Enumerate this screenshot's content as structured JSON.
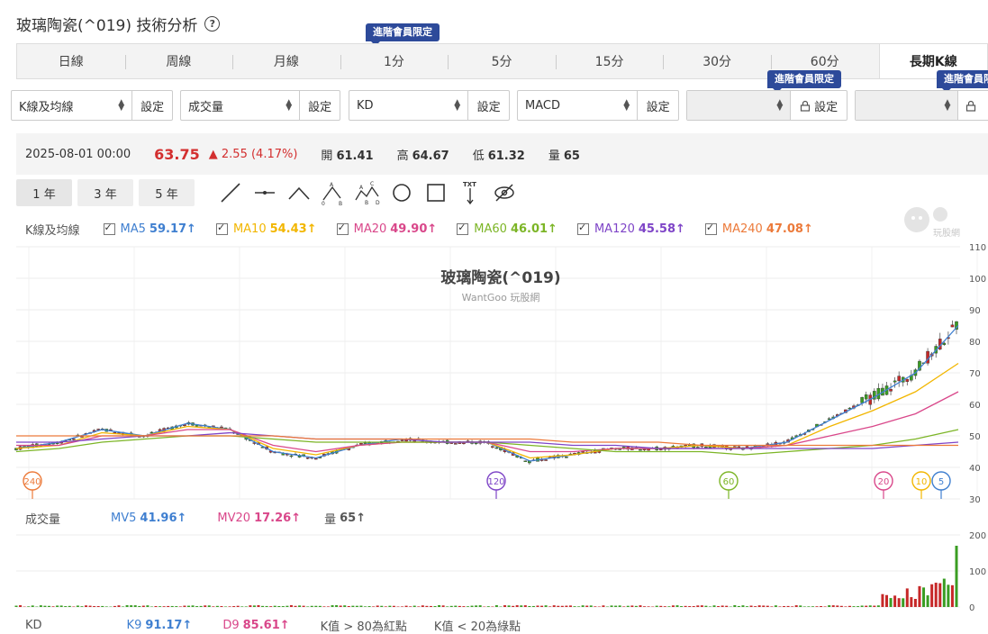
{
  "page": {
    "title": "玻璃陶瓷(^019) 技術分析",
    "help_icon": "help-icon"
  },
  "badges": {
    "minute": "進階會員限定",
    "settings": "進階會員限定",
    "settings2": "進階會員限定"
  },
  "tabs": [
    {
      "label": "日線"
    },
    {
      "label": "周線"
    },
    {
      "label": "月線"
    },
    {
      "label": "1分"
    },
    {
      "label": "5分"
    },
    {
      "label": "15分"
    },
    {
      "label": "30分"
    },
    {
      "label": "60分"
    },
    {
      "label": "長期K線",
      "active": true
    }
  ],
  "controls": {
    "sel1": "K線及均線",
    "sel2": "成交量",
    "sel3": "KD",
    "sel4": "MACD",
    "sel5": "",
    "sel6": "",
    "set_label": "設定"
  },
  "quote": {
    "date": "2025-08-01 00:00",
    "price": "63.75",
    "change": "▲ 2.55 (4.17%)",
    "open_label": "開",
    "open": "61.41",
    "high_label": "高",
    "high": "64.67",
    "low_label": "低",
    "low": "61.32",
    "vol_label": "量",
    "vol": "65"
  },
  "ranges": [
    "1 年",
    "3 年",
    "5 年"
  ],
  "ma": {
    "label": "K線及均線",
    "items": [
      {
        "name": "MA5",
        "value": "59.17↑",
        "color": "#3f7fd0"
      },
      {
        "name": "MA10",
        "value": "54.43↑",
        "color": "#f2b600"
      },
      {
        "name": "MA20",
        "value": "49.90↑",
        "color": "#d9478a"
      },
      {
        "name": "MA60",
        "value": "46.01↑",
        "color": "#7cb526"
      },
      {
        "name": "MA120",
        "value": "45.58↑",
        "color": "#7e44c7"
      },
      {
        "name": "MA240",
        "value": "47.08↑",
        "color": "#ec7a3a"
      }
    ]
  },
  "chart": {
    "title": "玻璃陶瓷(^019)",
    "subtitle": "WantGoo 玩股網",
    "logo_text": "玩股網",
    "y_ticks": [
      "110",
      "100",
      "90",
      "80",
      "70",
      "60",
      "50",
      "40",
      "30"
    ],
    "markers": [
      "240",
      "120",
      "60",
      "20",
      "10",
      "5"
    ]
  },
  "volume": {
    "label": "成交量",
    "mv5_name": "MV5",
    "mv5": "41.96↑",
    "mv20_name": "MV20",
    "mv20": "17.26↑",
    "q_name": "量",
    "q": "65↑",
    "y_ticks": [
      "200",
      "100",
      "0"
    ]
  },
  "kd": {
    "label": "KD",
    "k_name": "K9",
    "k": "91.17↑",
    "d_name": "D9",
    "d": "85.61↑",
    "note1": "K值 > 80為紅點",
    "note2": "K值 < 20為綠點"
  },
  "chart_data": {
    "type": "line",
    "title": "玻璃陶瓷(^019)",
    "ylim": [
      30,
      110
    ],
    "series": [
      {
        "name": "MA5",
        "values": [
          46,
          48,
          52,
          50,
          54,
          52,
          45,
          43,
          47,
          49,
          48,
          48,
          42,
          44,
          46,
          46,
          47,
          46,
          48,
          55,
          62,
          70,
          85
        ]
      },
      {
        "name": "MA10",
        "values": [
          46,
          47,
          51,
          50,
          53,
          52,
          46,
          44,
          47,
          48,
          48,
          48,
          43,
          44,
          46,
          46,
          47,
          46,
          47,
          53,
          58,
          64,
          73
        ]
      },
      {
        "name": "MA20",
        "values": [
          47,
          47,
          50,
          50,
          52,
          52,
          47,
          45,
          47,
          48,
          48,
          48,
          45,
          45,
          46,
          46,
          46,
          46,
          47,
          50,
          53,
          57,
          64
        ]
      },
      {
        "name": "MA60",
        "values": [
          45,
          46,
          48,
          49,
          50,
          50,
          49,
          48,
          48,
          48,
          48,
          48,
          47,
          46,
          45,
          45,
          45,
          44,
          45,
          46,
          47,
          49,
          52
        ]
      },
      {
        "name": "MA120",
        "values": [
          48,
          48,
          49,
          50,
          50,
          51,
          50,
          49,
          49,
          49,
          48,
          48,
          48,
          47,
          47,
          46,
          46,
          46,
          46,
          46,
          46,
          47,
          48
        ]
      },
      {
        "name": "MA240",
        "values": [
          50,
          50,
          50,
          50,
          50,
          50,
          50,
          49,
          49,
          49,
          49,
          49,
          49,
          48,
          48,
          48,
          47,
          47,
          47,
          47,
          47,
          47,
          47
        ]
      }
    ]
  }
}
